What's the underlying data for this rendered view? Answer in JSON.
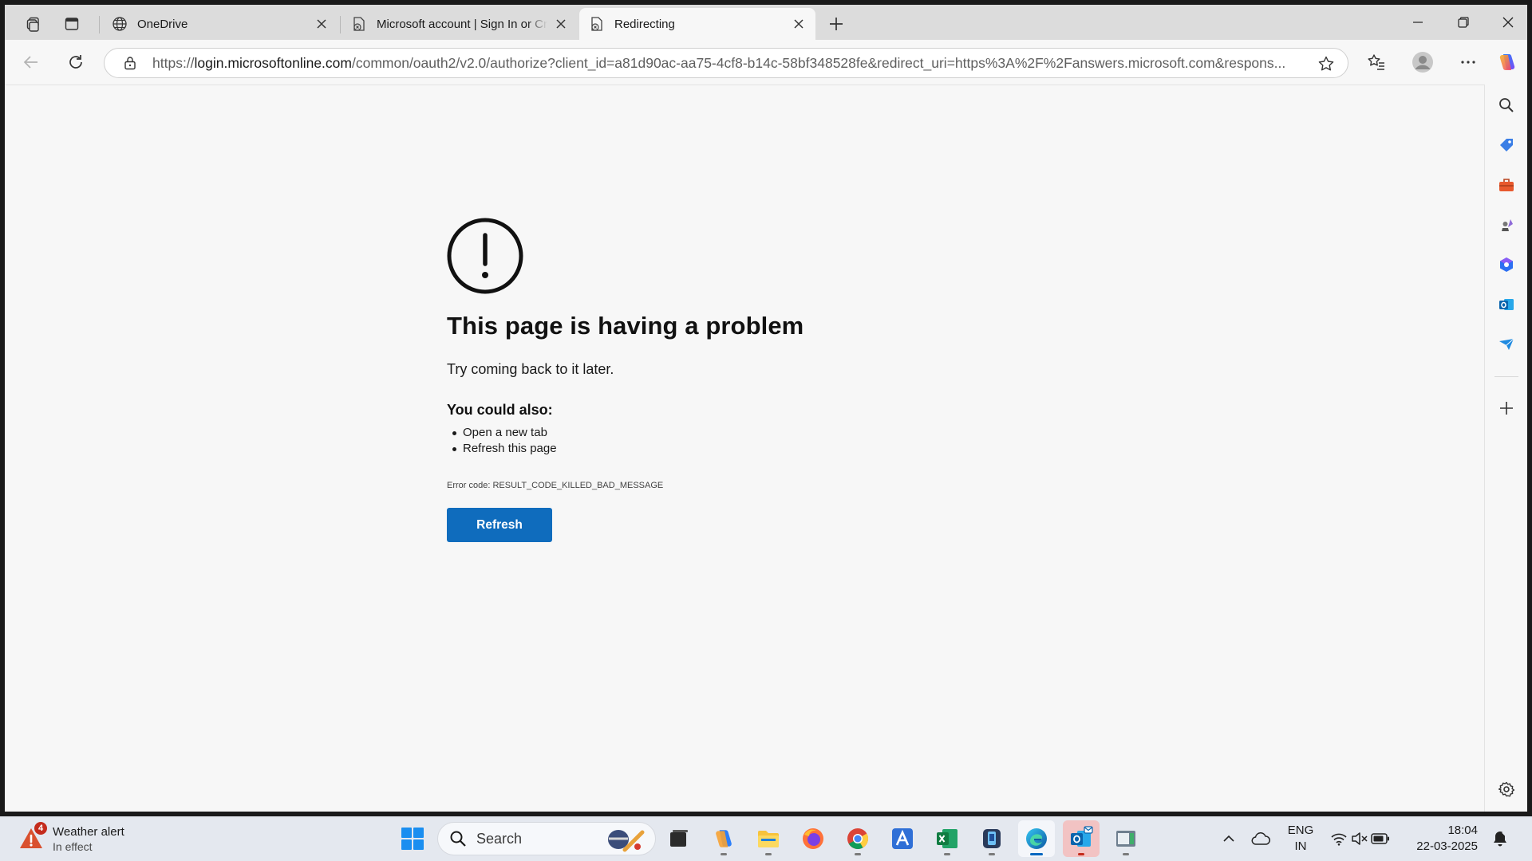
{
  "browser": {
    "tabs": [
      {
        "title": "OneDrive",
        "favicon": "globe-icon",
        "active": false
      },
      {
        "title": "Microsoft account | Sign In or Cre",
        "favicon": "page-error-icon",
        "active": false
      },
      {
        "title": "Redirecting",
        "favicon": "page-error-icon",
        "active": true
      }
    ],
    "url": {
      "scheme": "https://",
      "host": "login.microsoftonline.com",
      "rest": "/common/oauth2/v2.0/authorize?client_id=a81d90ac-aa75-4cf8-b14c-58bf348528fe&redirect_uri=https%3A%2F%2Fanswers.microsoft.com&respons..."
    },
    "sidebar_icons": [
      "search-icon",
      "shopping-tag-icon",
      "tools-icon",
      "games-icon",
      "microsoft365-icon",
      "outlook-icon",
      "drop-icon",
      "add-icon",
      "settings-icon"
    ]
  },
  "error_page": {
    "title": "This page is having a problem",
    "subtitle": "Try coming back to it later.",
    "also_heading": "You could also:",
    "suggestions": [
      "Open a new tab",
      "Refresh this page"
    ],
    "error_code": "Error code: RESULT_CODE_KILLED_BAD_MESSAGE",
    "refresh_label": "Refresh",
    "accent": "#0f6cbd"
  },
  "taskbar": {
    "weather": {
      "title": "Weather alert",
      "status": "In effect",
      "badge": "4"
    },
    "search_label": "Search",
    "apps": [
      "start-icon",
      "search",
      "file-manager-icon",
      "copilot-icon",
      "file-explorer-icon",
      "firefox-icon",
      "chrome-icon",
      "app-a-icon",
      "excel-icon",
      "phone-link-icon",
      "edge-icon",
      "outlook-icon",
      "remote-app-icon"
    ],
    "tray": {
      "lang1": "ENG",
      "lang2": "IN",
      "time": "18:04",
      "date": "22-03-2025"
    }
  }
}
